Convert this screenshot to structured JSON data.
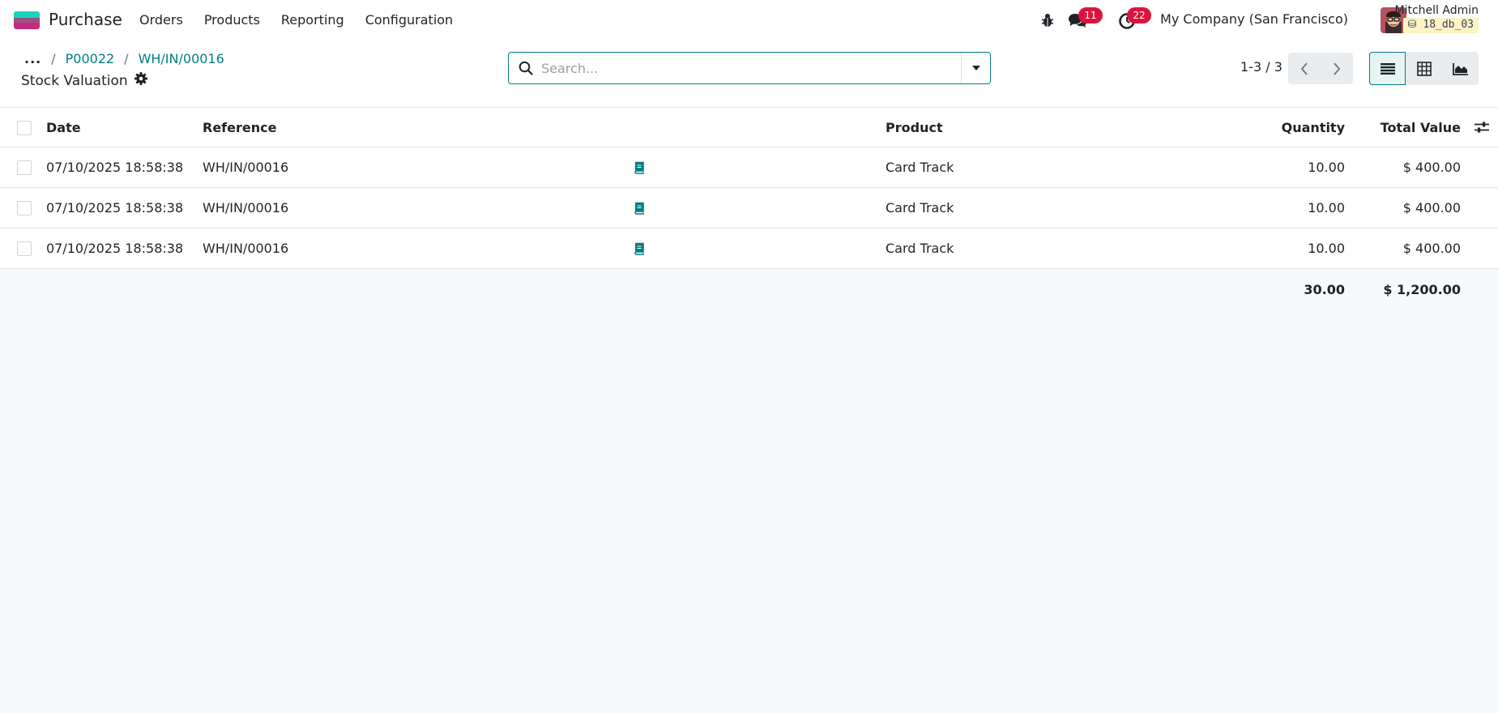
{
  "navbar": {
    "app_name": "Purchase",
    "menu": [
      "Orders",
      "Products",
      "Reporting",
      "Configuration"
    ],
    "messages_count": "11",
    "activities_count": "22",
    "company": "My Company (San Francisco)",
    "user_name": "Mitchell Admin",
    "database": "18_db_03"
  },
  "breadcrumb": {
    "ellipsis": "...",
    "items": [
      "P00022",
      "WH/IN/00016"
    ],
    "separator": "/"
  },
  "view": {
    "title": "Stock Valuation"
  },
  "search": {
    "placeholder": "Search..."
  },
  "pager": {
    "value": "1-3 / 3"
  },
  "table": {
    "columns": {
      "date": "Date",
      "reference": "Reference",
      "product": "Product",
      "quantity": "Quantity",
      "total_value": "Total Value"
    },
    "rows": [
      {
        "date": "07/10/2025 18:58:38",
        "reference": "WH/IN/00016",
        "product": "Card Track",
        "quantity": "10.00",
        "total_value": "$ 400.00"
      },
      {
        "date": "07/10/2025 18:58:38",
        "reference": "WH/IN/00016",
        "product": "Card Track",
        "quantity": "10.00",
        "total_value": "$ 400.00"
      },
      {
        "date": "07/10/2025 18:58:38",
        "reference": "WH/IN/00016",
        "product": "Card Track",
        "quantity": "10.00",
        "total_value": "$ 400.00"
      }
    ],
    "totals": {
      "quantity": "30.00",
      "total_value": "$ 1,200.00"
    }
  },
  "colors": {
    "accent": "#017e84",
    "badge": "#dc143c"
  }
}
